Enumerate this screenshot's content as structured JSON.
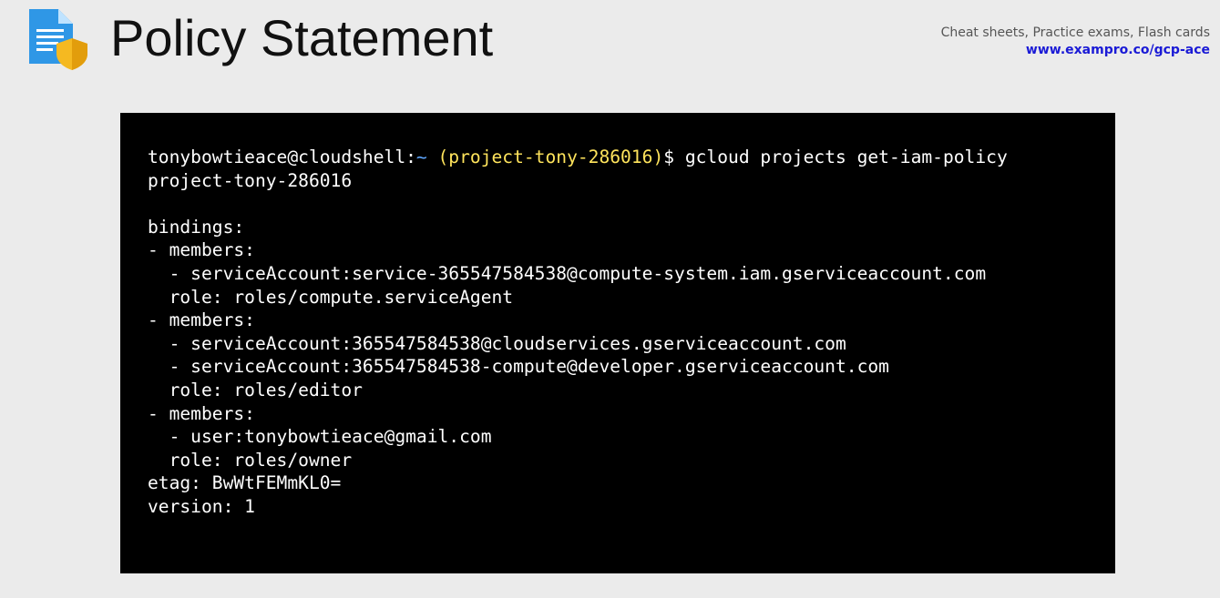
{
  "header": {
    "title": "Policy Statement",
    "icon": "document-shield-icon"
  },
  "promo": {
    "tagline": "Cheat sheets, Practice exams, Flash cards",
    "link": "www.exampro.co/gcp-ace",
    "link_color": "#1a1ad6"
  },
  "terminal": {
    "prompt_user_host": "tonybowtieace@cloudshell:",
    "prompt_dir": "~",
    "prompt_project": "(project-tony-286016)",
    "prompt_symbol": "$",
    "command": "gcloud projects get-iam-policy",
    "command_cont": "project-tony-286016",
    "output_lines": [
      "",
      "bindings:",
      "- members:",
      "  - serviceAccount:service-365547584538@compute-system.iam.gserviceaccount.com",
      "  role: roles/compute.serviceAgent",
      "- members:",
      "  - serviceAccount:365547584538@cloudservices.gserviceaccount.com",
      "  - serviceAccount:365547584538-compute@developer.gserviceaccount.com",
      "  role: roles/editor",
      "- members:",
      "  - user:tonybowtieace@gmail.com",
      "  role: roles/owner",
      "etag: BwWtFEMmKL0=",
      "version: 1"
    ],
    "colors": {
      "background": "#000000",
      "text": "#ffffff",
      "dir": "#5fa8ff",
      "project": "#ffe45c"
    }
  }
}
